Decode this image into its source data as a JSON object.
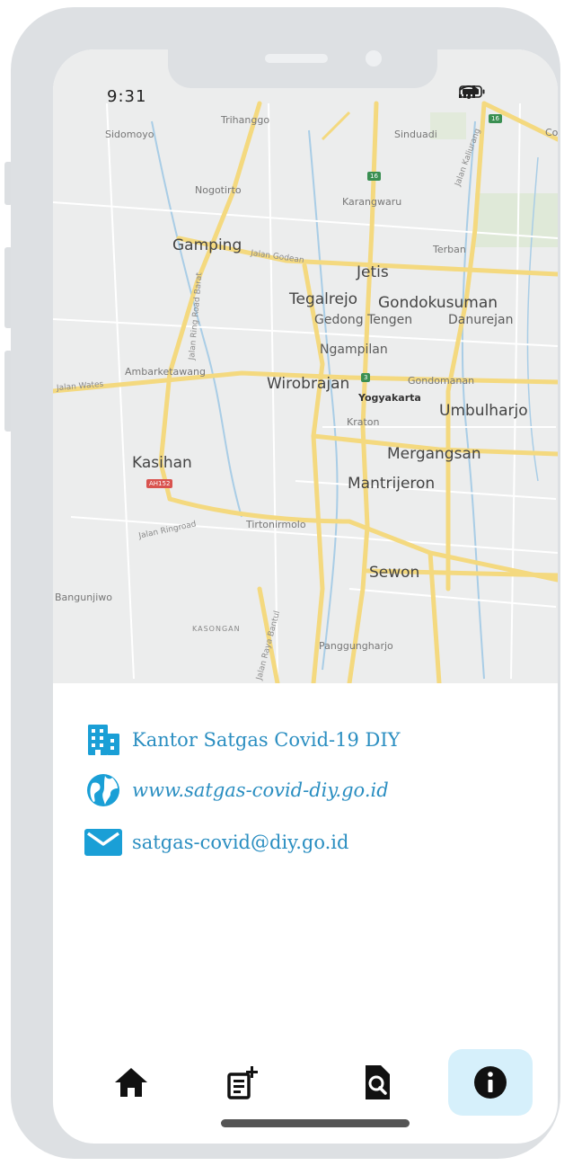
{
  "status_bar": {
    "time": "9:31"
  },
  "map": {
    "labels": {
      "sidomoyo": "Sidomoyo",
      "trihanggo": "Trihanggo",
      "sinduadi": "Sinduadi",
      "co": "Co",
      "nogotirto": "Nogotirto",
      "karangwaru": "Karangwaru",
      "jalan_kaliurang": "Jalan Kaliurang",
      "gamping": "Gamping",
      "jalan_godean": "Jalan Godean",
      "terban": "Terban",
      "jetis": "Jetis",
      "tegalrejo": "Tegalrejo",
      "gondokusuman": "Gondokusuman",
      "gedong_tengen": "Gedong Tengen",
      "danurejan": "Danurejan",
      "ngampilan": "Ngampilan",
      "jalan_ring_road_barat": "Jalan Ring Road Barat",
      "ambarketawang": "Ambarketawang",
      "jalan_wates": "Jalan Wates",
      "wirobrajan": "Wirobrajan",
      "gondomanan": "Gondomanan",
      "yogyakarta": "Yogyakarta",
      "umbulharjo": "Umbulharjo",
      "kraton": "Kraton",
      "mergangsan": "Mergangsan",
      "kasihan": "Kasihan",
      "mantrijeron": "Mantrijeron",
      "tirtonirmolo": "Tirtonirmolo",
      "jalan_ringroad": "Jalan Ringroad",
      "sewon": "Sewon",
      "bangunjiwo": "Bangunjiwo",
      "kasongan": "KASONGAN",
      "panggungharjo": "Panggungharjo",
      "jalan_raya_bantul": "Jalan Raya Bantul"
    },
    "shields": {
      "s1": "16",
      "s2": "16",
      "s3": "3",
      "s4": "AH152"
    }
  },
  "info": {
    "office": {
      "icon": "building-icon",
      "text": "Kantor Satgas Covid-19 DIY"
    },
    "website": {
      "icon": "globe-icon",
      "text": "www.satgas-covid-diy.go.id"
    },
    "email": {
      "icon": "mail-icon",
      "text": "satgas-covid@diy.go.id"
    }
  },
  "bottom_nav": {
    "items": [
      {
        "icon": "home-icon",
        "active": false
      },
      {
        "icon": "add-note-icon",
        "active": false
      },
      {
        "icon": "document-search-icon",
        "active": false
      },
      {
        "icon": "info-icon",
        "active": true
      }
    ]
  },
  "colors": {
    "accent": "#2a8ec1",
    "icon_blue": "#1a9fd6",
    "active_bg": "#d6f0fb",
    "frame": "#dde0e3"
  }
}
